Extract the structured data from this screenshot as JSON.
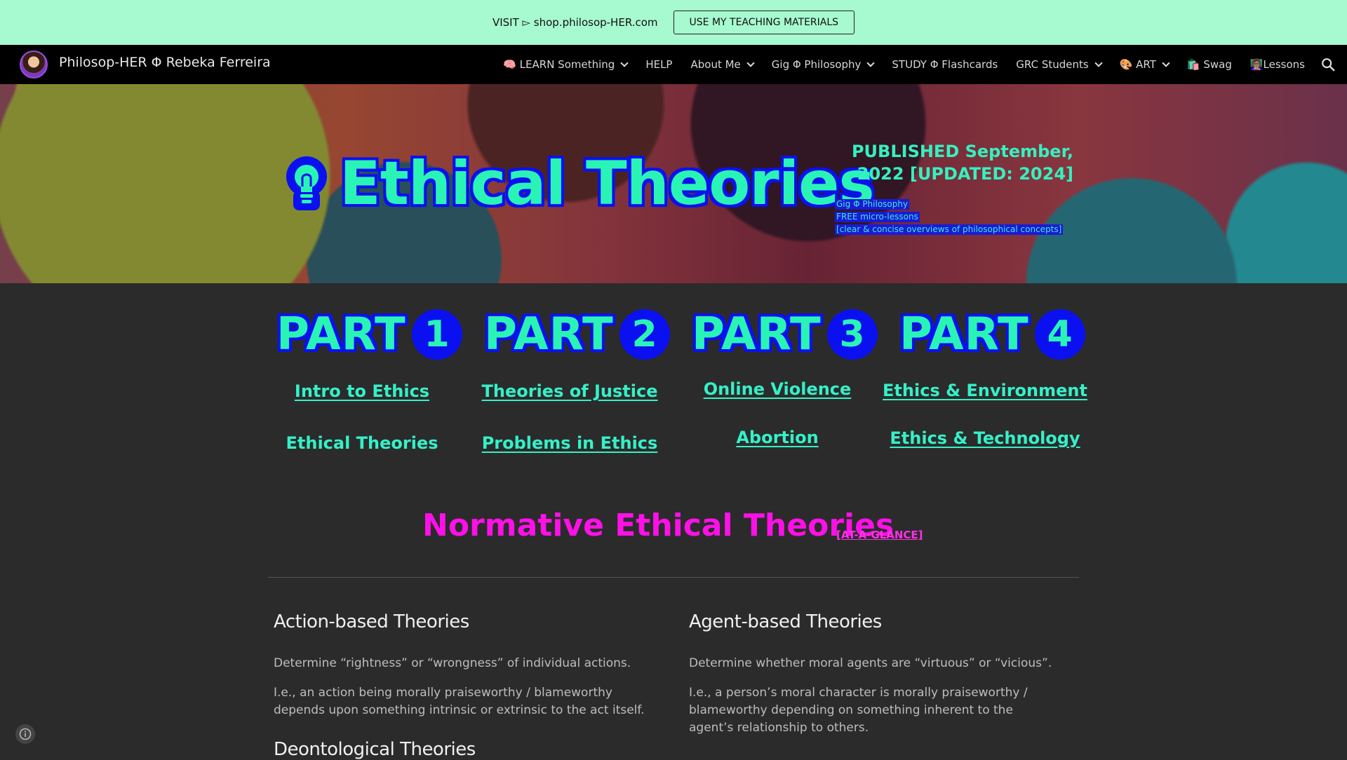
{
  "banner": {
    "text": "VISIT ▻ shop.philosop-HER.com",
    "button_label": "USE MY TEACHING MATERIALS"
  },
  "header": {
    "site_title": "Philosop-HER Φ Rebeka Ferreira",
    "nav": [
      {
        "label": "🧠 LEARN Something",
        "has_dropdown": true
      },
      {
        "label": "HELP",
        "has_dropdown": false
      },
      {
        "label": "About Me",
        "has_dropdown": true
      },
      {
        "label": "Gig Φ Philosophy",
        "has_dropdown": true
      },
      {
        "label": "STUDY Φ Flashcards",
        "has_dropdown": false
      },
      {
        "label": "GRC Students",
        "has_dropdown": true
      },
      {
        "label": "🎨 ART",
        "has_dropdown": true
      },
      {
        "label": "🛍️ Swag",
        "has_dropdown": false
      },
      {
        "label": "👩🏽‍🏫Lessons",
        "has_dropdown": false
      }
    ],
    "search_icon": "search-icon"
  },
  "hero": {
    "bulb_icon": "lightbulb-icon",
    "title": "Ethical Theories",
    "published_line1": "PUBLISHED September,",
    "published_line2": "2022 [UPDATED: 2024]",
    "meta_line1": "Gig Φ Philosophy",
    "meta_line2": "FREE micro-lessons",
    "meta_line3": "[clear & concise overviews of philosophical concepts]"
  },
  "parts": [
    {
      "word": "PART",
      "number": "1",
      "topic1": "Intro to Ethics",
      "topic1_link": true,
      "topic2": "Ethical Theories",
      "topic2_link": false
    },
    {
      "word": "PART",
      "number": "2",
      "topic1": "Theories of Justice",
      "topic1_link": true,
      "topic2": "Problems in Ethics",
      "topic2_link": true
    },
    {
      "word": "PART",
      "number": "3",
      "topic1": "Online Violence",
      "topic1_link": true,
      "topic2": "Abortion",
      "topic2_link": true
    },
    {
      "word": "PART",
      "number": "4",
      "topic1": "Ethics & Environment",
      "topic1_link": true,
      "topic2": "Ethics & Technology",
      "topic2_link": true
    }
  ],
  "section": {
    "title": "Normative Ethical Theories",
    "glance_link": "[AT-A-GLANCE]"
  },
  "columns": {
    "left": {
      "heading": "Action-based Theories",
      "p1": "Determine “rightness” or “wrongness” of individual actions.",
      "p2": "I.e., an action being morally praiseworthy / blameworthy depends upon something intrinsic or extrinsic to the act itself.",
      "next_heading": "Deontological Theories"
    },
    "right": {
      "heading": "Agent-based Theories",
      "p1": "Determine whether moral agents are “virtuous” or “vicious”.",
      "p2": "I.e., a person’s moral character is morally praiseworthy / blameworthy depending on something inherent to the agent’s relationship to others."
    }
  },
  "colors": {
    "banner_bg": "#a7f9cf",
    "accent_teal": "#29f4b6",
    "accent_blue": "#0a10f0",
    "accent_magenta": "#ff10e8",
    "page_bg": "#2b2b2b"
  }
}
